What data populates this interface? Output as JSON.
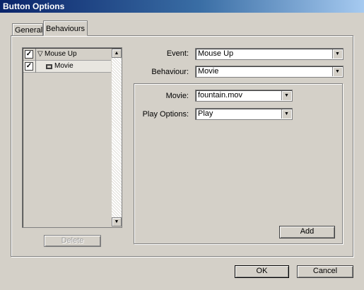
{
  "window": {
    "title": "Button Options"
  },
  "tabs": [
    {
      "label": "General"
    },
    {
      "label": "Behaviours"
    }
  ],
  "event_list": {
    "items": [
      {
        "checked": true,
        "label": "Mouse Up",
        "expander": "▽"
      },
      {
        "checked": true,
        "label": "Movie",
        "expander": ""
      }
    ]
  },
  "delete_label": "Delete",
  "form": {
    "event_label": "Event:",
    "event_value": "Mouse Up",
    "behaviour_label": "Behaviour:",
    "behaviour_value": "Movie",
    "movie_label": "Movie:",
    "movie_value": "fountain.mov",
    "play_options_label": "Play Options:",
    "play_options_value": "Play",
    "add_label": "Add"
  },
  "footer": {
    "ok_label": "OK",
    "cancel_label": "Cancel"
  },
  "colors": {
    "title_start": "#0a246a",
    "title_end": "#a6caf0",
    "face": "#d4d0c8"
  },
  "icons": [
    "expand-triangle-icon",
    "movie-action-icon",
    "scroll-up-icon",
    "scroll-down-icon",
    "dropdown-arrow-icon",
    "checkmark-icon"
  ]
}
